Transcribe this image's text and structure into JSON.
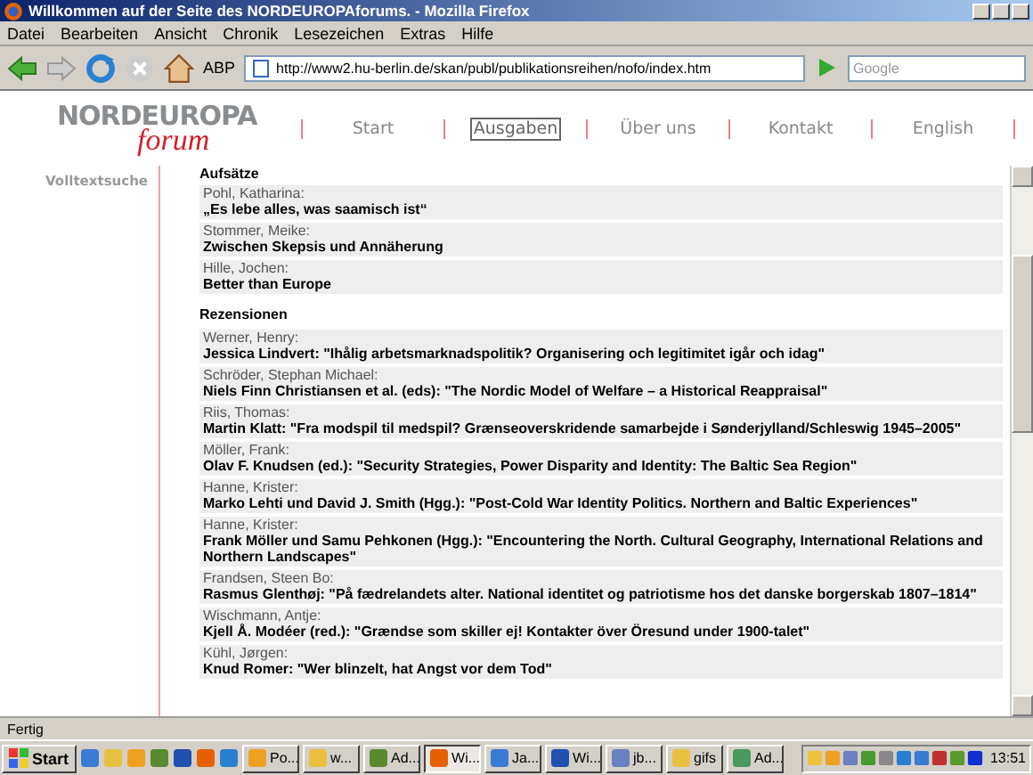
{
  "window": {
    "title": "Willkommen auf der Seite des NORDEUROPAforums. - Mozilla Firefox"
  },
  "menu": [
    "Datei",
    "Bearbeiten",
    "Ansicht",
    "Chronik",
    "Lesezeichen",
    "Extras",
    "Hilfe"
  ],
  "toolbar": {
    "url": "http://www2.hu-berlin.de/skan/publ/publikationsreihen/nofo/index.htm",
    "search_placeholder": "Google",
    "adblock_label": "ABP"
  },
  "page": {
    "logo": {
      "top": "NORDEUROPA",
      "bottom": "forum"
    },
    "nav": [
      {
        "label": "Start",
        "selected": false
      },
      {
        "label": "Ausgaben",
        "selected": true
      },
      {
        "label": "Über uns",
        "selected": false
      },
      {
        "label": "Kontakt",
        "selected": false
      },
      {
        "label": "English",
        "selected": false
      }
    ],
    "sidebar": [
      {
        "label": "Volltextsuche"
      }
    ],
    "sections": [
      {
        "heading": "Aufsätze",
        "entries": [
          {
            "author": "Pohl, Katharina:",
            "title": "„Es lebe alles, was saamisch ist“"
          },
          {
            "author": "Stommer, Meike:",
            "title": "Zwischen Skepsis und Annäherung"
          },
          {
            "author": "Hille, Jochen:",
            "title": "Better than Europe"
          }
        ]
      },
      {
        "heading": "Rezensionen",
        "entries": [
          {
            "author": "Werner, Henry:",
            "title": "Jessica Lindvert: \"Ihålig arbetsmarknadspolitik? Organisering och legitimitet igår och idag\""
          },
          {
            "author": "Schröder, Stephan Michael:",
            "title": "Niels Finn Christiansen et al. (eds): \"The Nordic Model of Welfare – a Historical Reappraisal\""
          },
          {
            "author": "Riis, Thomas:",
            "title": "Martin Klatt: \"Fra modspil til medspil? Grænseoverskridende samarbejde i Sønderjylland/Schleswig 1945–2005\""
          },
          {
            "author": "Möller, Frank:",
            "title": "Olav F. Knudsen (ed.): \"Security Strategies, Power Disparity and Identity: The Baltic Sea Region\""
          },
          {
            "author": "Hanne, Krister:",
            "title": "Marko Lehti und David J. Smith (Hgg.): \"Post-Cold War Identity Politics. Northern and Baltic Experiences\""
          },
          {
            "author": "Hanne, Krister:",
            "title": "Frank Möller und Samu Pehkonen (Hgg.): \"Encountering the North. Cultural Geography, International Relations and Northern Landscapes\""
          },
          {
            "author": "Frandsen, Steen Bo:",
            "title": "Rasmus Glenthøj: \"På fædrelandets alter. National identitet og patriotisme hos det danske borgerskab 1807–1814\""
          },
          {
            "author": "Wischmann, Antje:",
            "title": "Kjell Å. Modéer (red.): \"Grændse som skiller ej! Kontakter över Öresund under 1900-talet\""
          },
          {
            "author": "Kühl, Jørgen:",
            "title": "Knud Romer: \"Wer blinzelt, hat Angst vor dem Tod\""
          }
        ]
      }
    ]
  },
  "status_bar": {
    "text": "Fertig"
  },
  "taskbar": {
    "start": "Start",
    "tasks": [
      {
        "label": "Po...",
        "selected": false
      },
      {
        "label": "w...",
        "selected": false
      },
      {
        "label": "Ad...",
        "selected": false
      },
      {
        "label": "Wi...",
        "selected": true
      },
      {
        "label": "Ja...",
        "selected": false
      },
      {
        "label": "Wi...",
        "selected": false
      },
      {
        "label": "jb...",
        "selected": false
      },
      {
        "label": "gifs",
        "selected": false
      },
      {
        "label": "Ad...",
        "selected": false
      }
    ],
    "clock": "13:51"
  }
}
